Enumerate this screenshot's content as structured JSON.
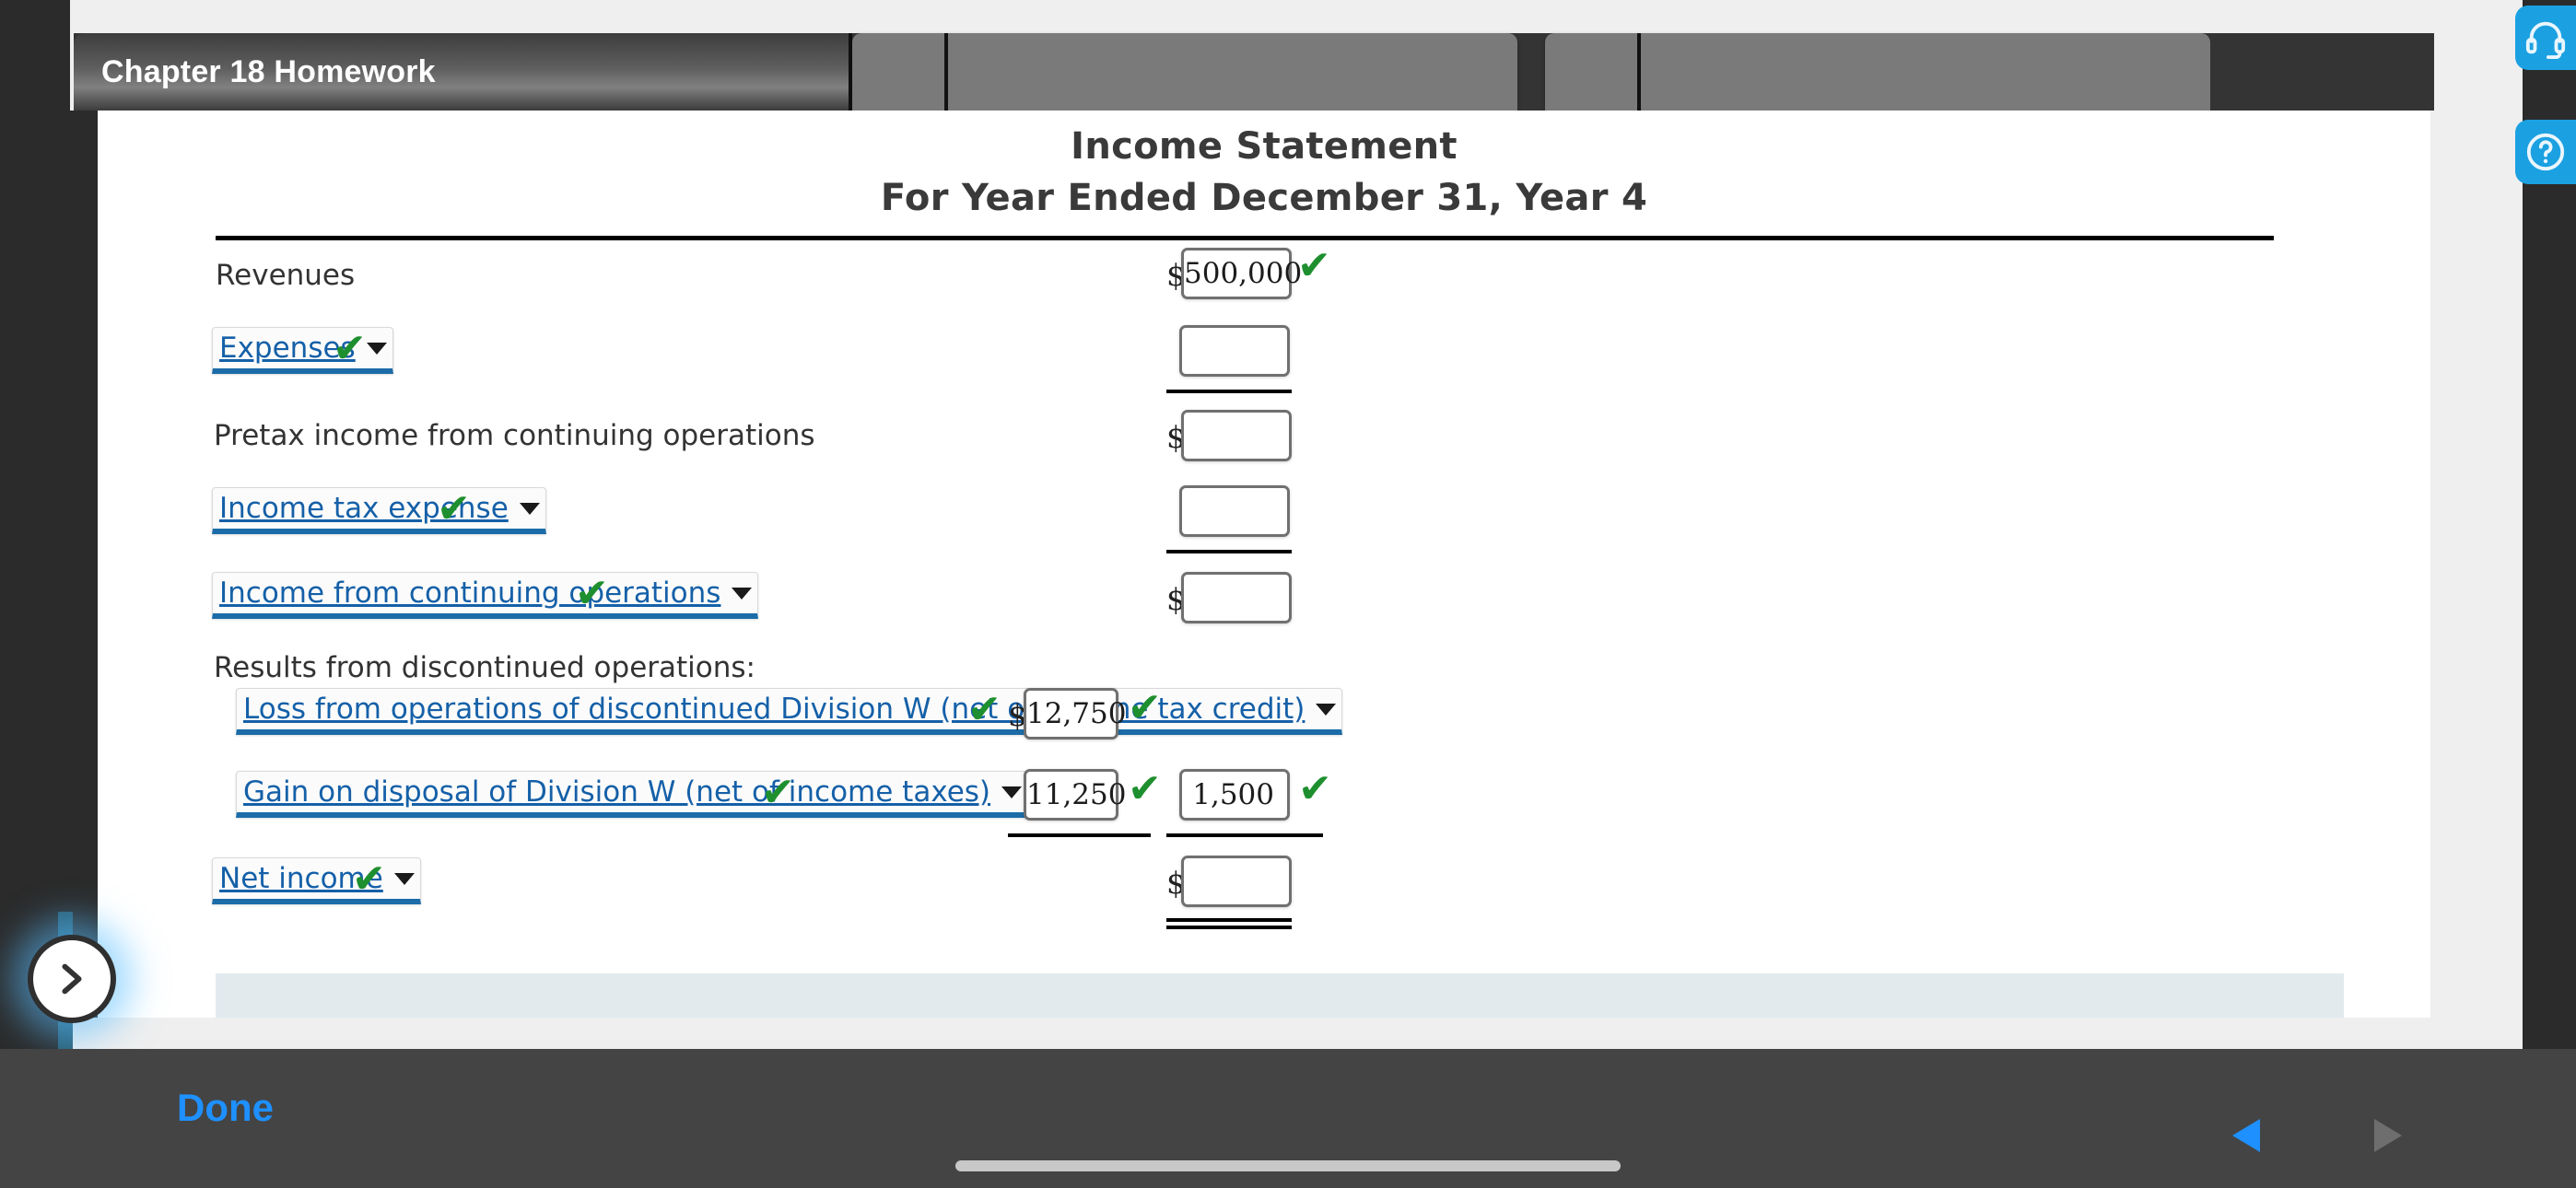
{
  "window": {
    "tab_title": "Chapter 18 Homework",
    "tabs": [
      {
        "label": ""
      },
      {
        "label": ""
      }
    ]
  },
  "statement": {
    "title": "Income Statement",
    "subtitle": "For Year Ended December 31, Year 4",
    "currency_symbol": "$",
    "check_mark": "✔",
    "rows": [
      {
        "type": "plain",
        "label": "Revenues",
        "dollar": "$",
        "value": "500,000",
        "verified": true
      },
      {
        "type": "dropdown",
        "label": "Expenses",
        "dollar": "",
        "value": "",
        "verified": true
      },
      {
        "type": "plain",
        "label": "Pretax income from continuing operations",
        "dollar": "$",
        "value": "",
        "verified": false
      },
      {
        "type": "dropdown",
        "label": "Income tax expense",
        "dollar": "",
        "value": "",
        "verified": true
      },
      {
        "type": "dropdown",
        "label": "Income from continuing operations",
        "dollar": "$",
        "value": "",
        "verified": true
      },
      {
        "type": "plain",
        "label": "Results from discontinued operations:",
        "dollar": "",
        "value": "",
        "verified": false
      },
      {
        "type": "dropdown-indent",
        "label": "Loss from operations of discontinued Division W (net of income tax credit)",
        "dollar": "$",
        "value": "12,750",
        "verified": true
      },
      {
        "type": "dropdown-indent",
        "label": "Gain on disposal of Division W (net of income taxes)",
        "dollar": "",
        "value": "11,250",
        "value2": "1,500",
        "verified": true
      },
      {
        "type": "dropdown",
        "label": "Net income",
        "dollar": "$",
        "value": "",
        "verified": true
      }
    ]
  },
  "footer": {
    "done_label": "Done",
    "prev_icon": "triangle-left-icon",
    "next_icon": "triangle-right-icon"
  },
  "side_widgets": {
    "support_icon": "headset-icon",
    "help_icon": "question-circle-icon"
  },
  "nav": {
    "expand_icon": "chevron-right-icon"
  },
  "colors": {
    "accent_blue": "#1e90ff",
    "link_blue": "#1560a8",
    "dropdown_underline": "#1b6ca8",
    "check_green": "#1e8f2e",
    "side_widget_blue": "#1ba1e2",
    "toolbar_dark": "#444444"
  }
}
